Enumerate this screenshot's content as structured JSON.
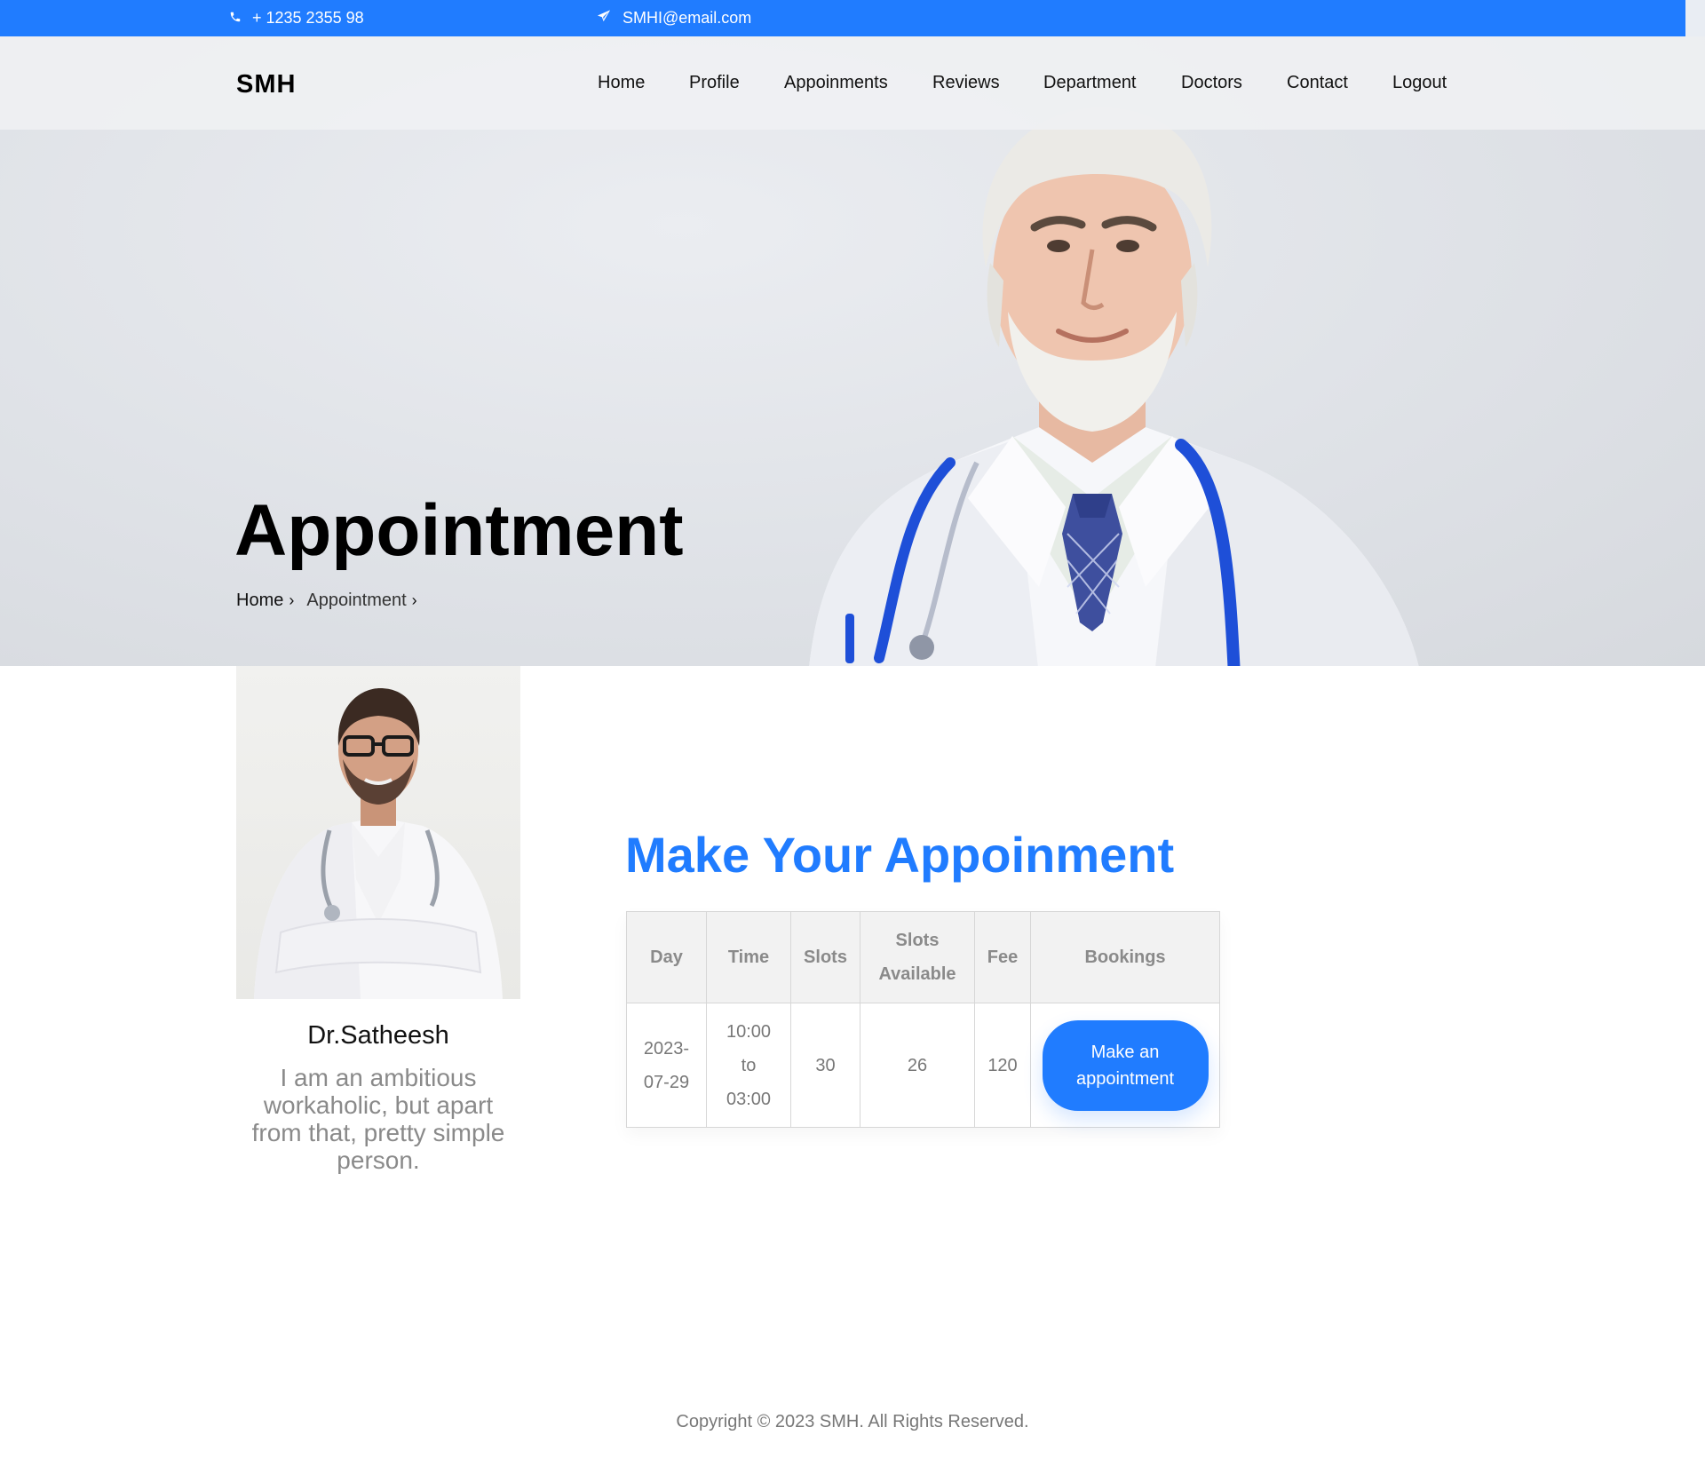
{
  "topbar": {
    "phone": "+ 1235 2355 98",
    "email": "SMHI@email.com",
    "phone_icon": "phone-icon",
    "email_icon": "paper-plane-icon",
    "color": "#207cff"
  },
  "brand": {
    "logo": "SMH"
  },
  "nav": {
    "items": [
      {
        "label": "Home"
      },
      {
        "label": "Profile"
      },
      {
        "label": "Appoinments"
      },
      {
        "label": "Reviews"
      },
      {
        "label": "Department"
      },
      {
        "label": "Doctors"
      },
      {
        "label": "Contact"
      },
      {
        "label": "Logout"
      }
    ]
  },
  "hero": {
    "title": "Appointment",
    "breadcrumb": {
      "home": "Home",
      "current": "Appointment",
      "separator": "›"
    }
  },
  "doctor": {
    "name": "Dr.Satheesh",
    "bio": "I am an ambitious workaholic, but apart from that, pretty simple person."
  },
  "appointment": {
    "title": "Make Your Appoinment",
    "columns": [
      "Day",
      "Time",
      "Slots",
      "Slots Available",
      "Fee",
      "Bookings"
    ],
    "rows": [
      {
        "day": "2023-07-29",
        "time": "10:00 to 03:00",
        "slots": "30",
        "available": "26",
        "fee": "120",
        "button": "Make an appointment"
      }
    ]
  },
  "footer": {
    "copyright": "Copyright © 2023 SMH. All Rights Reserved."
  },
  "accent_color": "#207cff"
}
